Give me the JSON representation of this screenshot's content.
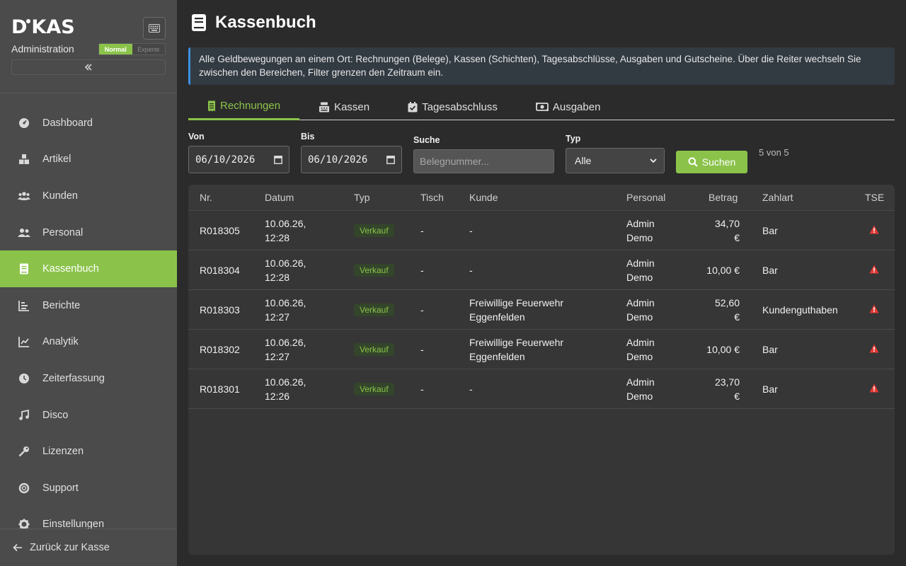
{
  "sidebar": {
    "logo": {
      "left": "D",
      "right": "KAS"
    },
    "subtitle": "Administration",
    "mode": {
      "normal": "Normal",
      "expert": "Experte"
    },
    "items": [
      {
        "label": "Dashboard",
        "icon": "gauge-icon"
      },
      {
        "label": "Artikel",
        "icon": "boxes-icon"
      },
      {
        "label": "Kunden",
        "icon": "users-icon"
      },
      {
        "label": "Personal",
        "icon": "user-group-icon"
      },
      {
        "label": "Kassenbuch",
        "icon": "book-icon",
        "active": true
      },
      {
        "label": "Berichte",
        "icon": "bar-chart-icon"
      },
      {
        "label": "Analytik",
        "icon": "line-chart-icon"
      },
      {
        "label": "Zeiterfassung",
        "icon": "clock-icon"
      },
      {
        "label": "Disco",
        "icon": "music-icon"
      },
      {
        "label": "Lizenzen",
        "icon": "key-icon"
      },
      {
        "label": "Support",
        "icon": "lifebuoy-icon"
      },
      {
        "label": "Einstellungen",
        "icon": "gear-icon"
      }
    ],
    "back": "Zurück zur Kasse"
  },
  "page": {
    "title": "Kassenbuch",
    "info": "Alle Geldbewegungen an einem Ort: Rechnungen (Belege), Kassen (Schichten), Tagesabschlüsse, Ausgaben und Gutscheine. Über die Reiter wechseln Sie zwischen den Bereichen, Filter grenzen den Zeitraum ein."
  },
  "tabs": [
    "Rechnungen",
    "Kassen",
    "Tagesabschluss",
    "Ausgaben"
  ],
  "filters": {
    "from_label": "Von",
    "from_value": "06/10/2026",
    "to_label": "Bis",
    "to_value": "06/10/2026",
    "search_label": "Suche",
    "search_placeholder": "Belegnummer...",
    "type_label": "Typ",
    "type_value": "Alle",
    "search_button": "Suchen",
    "count": "5 von 5"
  },
  "table": {
    "headers": [
      "Nr.",
      "Datum",
      "Typ",
      "Tisch",
      "Kunde",
      "Personal",
      "Betrag",
      "Zahlart",
      "TSE"
    ],
    "rows": [
      {
        "nr": "R018305",
        "date1": "10.06.26,",
        "date2": "12:28",
        "typ": "Verkauf",
        "tisch": "-",
        "kunde1": "-",
        "kunde2": "",
        "p1": "Admin",
        "p2": "Demo",
        "b1": "34,70",
        "b2": "€",
        "zahlart": "Bar"
      },
      {
        "nr": "R018304",
        "date1": "10.06.26,",
        "date2": "12:28",
        "typ": "Verkauf",
        "tisch": "-",
        "kunde1": "-",
        "kunde2": "",
        "p1": "Admin",
        "p2": "Demo",
        "b1": "10,00 €",
        "b2": "",
        "zahlart": "Bar"
      },
      {
        "nr": "R018303",
        "date1": "10.06.26,",
        "date2": "12:27",
        "typ": "Verkauf",
        "tisch": "-",
        "kunde1": "Freiwillige Feuerwehr",
        "kunde2": "Eggenfelden",
        "p1": "Admin",
        "p2": "Demo",
        "b1": "52,60",
        "b2": "€",
        "zahlart": "Kundenguthaben"
      },
      {
        "nr": "R018302",
        "date1": "10.06.26,",
        "date2": "12:27",
        "typ": "Verkauf",
        "tisch": "-",
        "kunde1": "Freiwillige Feuerwehr",
        "kunde2": "Eggenfelden",
        "p1": "Admin",
        "p2": "Demo",
        "b1": "10,00 €",
        "b2": "",
        "zahlart": "Bar"
      },
      {
        "nr": "R018301",
        "date1": "10.06.26,",
        "date2": "12:26",
        "typ": "Verkauf",
        "tisch": "-",
        "kunde1": "-",
        "kunde2": "",
        "p1": "Admin",
        "p2": "Demo",
        "b1": "23,70",
        "b2": "€",
        "zahlart": "Bar"
      }
    ]
  },
  "colors": {
    "accent": "#8bc34a",
    "warning": "#e53935",
    "info": "#3d8fe0"
  }
}
